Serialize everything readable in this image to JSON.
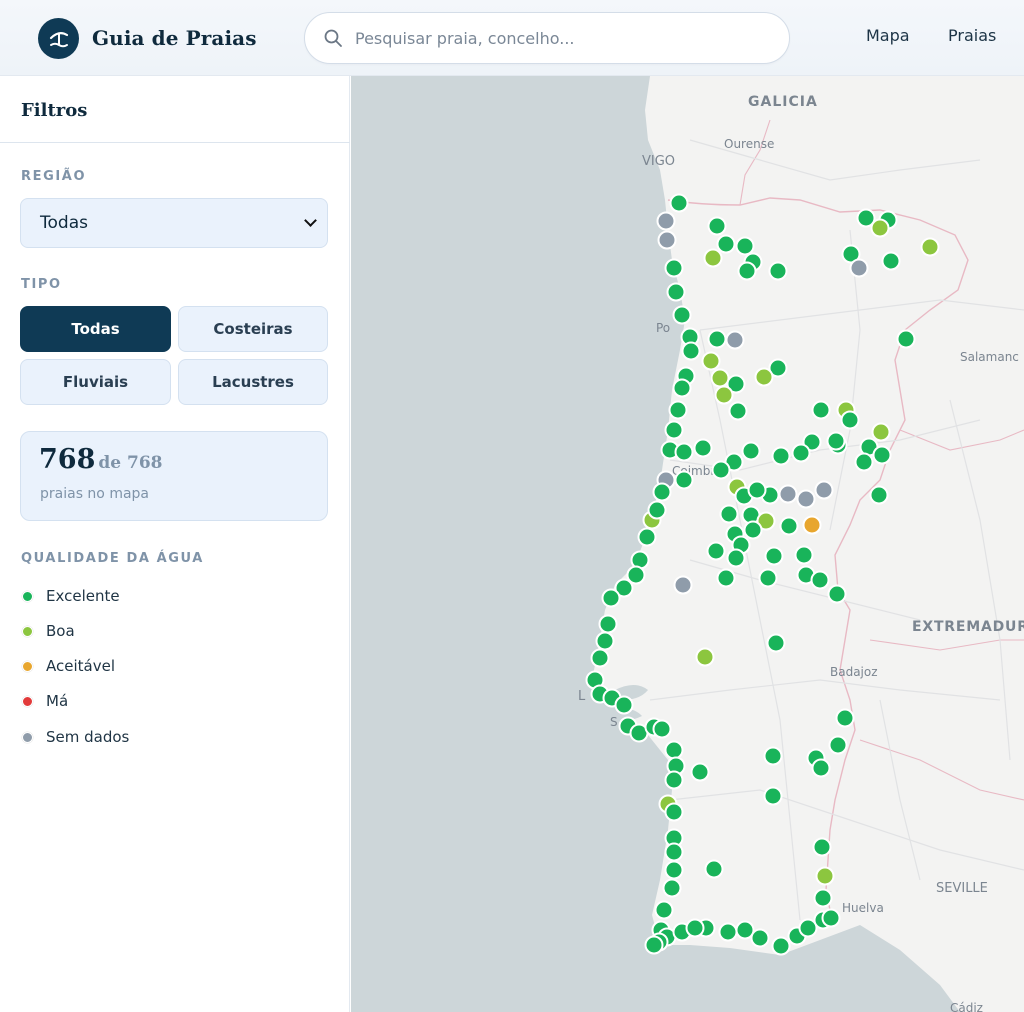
{
  "app": {
    "name": "Guia de Praias"
  },
  "search": {
    "placeholder": "Pesquisar praia, concelho..."
  },
  "nav": {
    "items": [
      "Mapa",
      "Praias"
    ]
  },
  "sidebar": {
    "title": "Filtros",
    "region": {
      "label": "REGIÃO",
      "selected": "Todas"
    },
    "type": {
      "label": "TIPO",
      "options": [
        "Todas",
        "Costeiras",
        "Fluviais",
        "Lacustres"
      ],
      "active": "Todas"
    },
    "count": {
      "shown": "768",
      "total_text": "de 768",
      "caption": "praias no mapa"
    },
    "legend": {
      "title": "QUALIDADE DA ÁGUA",
      "items": [
        {
          "label": "Excelente",
          "color": "#19b45a"
        },
        {
          "label": "Boa",
          "color": "#8cc63f"
        },
        {
          "label": "Aceitável",
          "color": "#e8a62e"
        },
        {
          "label": "Má",
          "color": "#e23a3a"
        },
        {
          "label": "Sem dados",
          "color": "#8f9caa"
        }
      ]
    }
  },
  "map": {
    "labels": [
      "GALICIA",
      "Ourense",
      "VIGO",
      "Po",
      "Salamanc",
      "Coimbra",
      "EXTREMADUR",
      "Badajoz",
      "L",
      "S",
      "SEVILLE",
      "Huelva",
      "Cádiz"
    ],
    "colors": {
      "sea": "#cdd6d9",
      "land": "#f3f3f2",
      "border": "#e8b9c4",
      "road": "#e0e1e3"
    }
  }
}
